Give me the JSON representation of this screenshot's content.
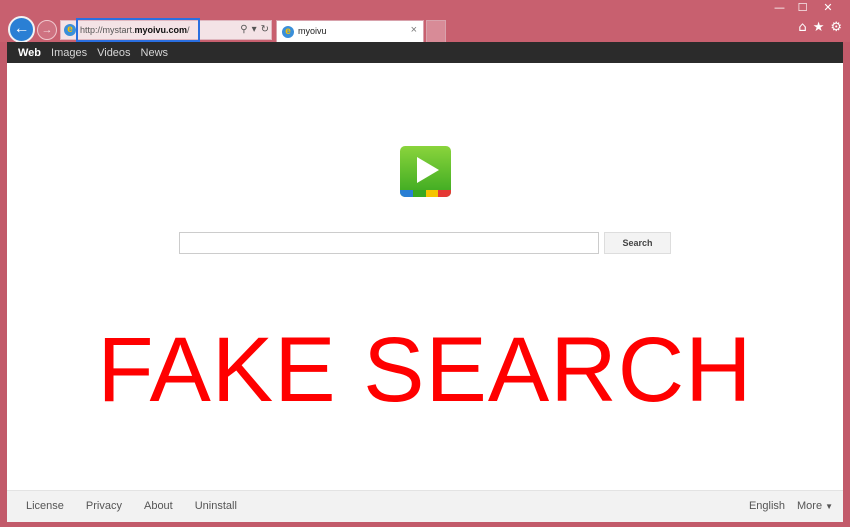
{
  "browser": {
    "url_prefix": "http://mystart.",
    "url_domain": "myoivu.com",
    "url_suffix": "/",
    "tab_title": "myoivu",
    "tab_close": "×",
    "back_glyph": "←",
    "forward_glyph": "→",
    "ie_glyph": "e",
    "addr_search_glyph": "⚲",
    "addr_dropdown_glyph": "▾",
    "addr_refresh_glyph": "↻",
    "home_glyph": "⌂",
    "favorites_glyph": "★",
    "settings_glyph": "⚙",
    "minimize_glyph": "—",
    "maximize_glyph": "☐",
    "close_glyph": "✕"
  },
  "nav": {
    "items": [
      {
        "label": "Web",
        "active": true
      },
      {
        "label": "Images",
        "active": false
      },
      {
        "label": "Videos",
        "active": false
      },
      {
        "label": "News",
        "active": false
      }
    ]
  },
  "search": {
    "value": "",
    "button_label": "Search"
  },
  "overlay": {
    "text": "FAKE SEARCH"
  },
  "footer": {
    "left_links": [
      "License",
      "Privacy",
      "About",
      "Uninstall"
    ],
    "language": "English",
    "more": "More",
    "more_caret": "▼"
  },
  "colors": {
    "frame": "#c8606f",
    "nav_bar": "#2b2b2b",
    "overlay_red": "#ff0000",
    "logo_green": "#39a820",
    "stripe": [
      "#2a7fd4",
      "#39a820",
      "#f5c400",
      "#e53935"
    ]
  },
  "icons": {
    "back": "back-arrow-icon",
    "forward": "forward-arrow-icon",
    "home": "home-icon",
    "favorites": "star-icon",
    "settings": "gear-icon",
    "logo": "play-logo-icon"
  }
}
